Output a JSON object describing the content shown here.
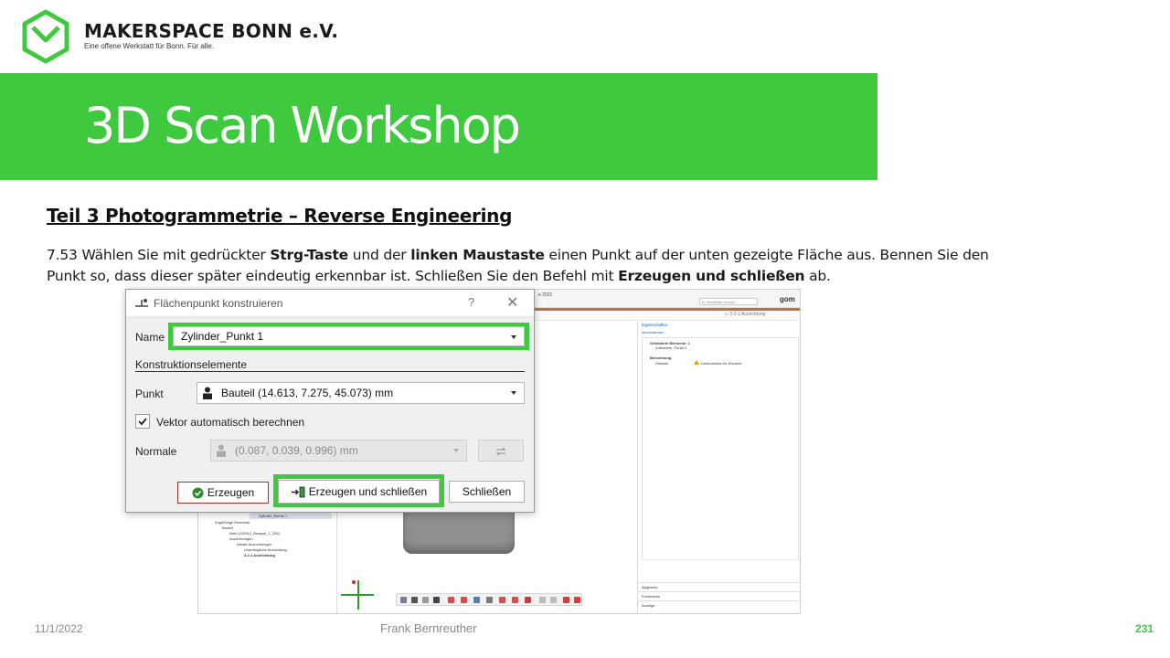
{
  "brand": {
    "name": "MAKERSPACE BONN e.V.",
    "tagline": "Eine offene Werkstatt für Bonn. Für alle.",
    "accent_color": "#3ec93e"
  },
  "banner": {
    "title": "3D Scan Workshop"
  },
  "section": {
    "heading": "Teil 3  Photogrammetrie  – Reverse Engineering"
  },
  "instruction": {
    "p1": "7.53 Wählen Sie mit gedrückter ",
    "b1": "Strg-Taste",
    "p2": " und der ",
    "b2": "linken Maustaste",
    "p3": " einen Punkt auf der unten gezeigte Fläche aus. Bennen Sie den Punkt so, dass dieser später eindeutig erkennbar ist. Schließen Sie den Befehl mit ",
    "b3": "Erzeugen und schließen",
    "p4": " ab."
  },
  "app": {
    "title_fragment": "e 2021",
    "search_placeholder": "In Direkthilfe suchen",
    "logo": "gom",
    "alignment_chip": "▷ 3-2-1 Ausrichtung",
    "tree": {
      "header": "Zylinder_Ebene 1",
      "items": [
        "Zugehörige Elemente",
        "Bauteil",
        "Netz (220912_Beispiel_1_206)",
        "Ausrichtungen",
        "Initiale Ausrichtungen",
        "Ursprüngliche Ausrichtung",
        "3-2-1 Ausrichtung"
      ]
    },
    "panel": {
      "tab": "Eigenschaften",
      "sub": "Informationen",
      "selected_heading": "Selektierte Elemente: 1",
      "selected_item": "Aufnahme_Punkt 4",
      "calc_heading": "Berechnung",
      "hint_label": "Hinweis",
      "hint_value": "Unbenutzbar für Element",
      "footer_items": [
        "Allgemein",
        "Fehlerchen",
        "Anzeige"
      ]
    }
  },
  "dialog": {
    "title": "Flächenpunkt konstruieren",
    "help": "?",
    "close": "✕",
    "name_label": "Name",
    "name_value": "Zylinder_Punkt 1",
    "group_label": "Konstruktionselemente",
    "point_label": "Punkt",
    "point_value": "Bauteil (14.613, 7.275, 45.073) mm",
    "auto_vector_label": "Vektor automatisch berechnen",
    "auto_vector_checked": true,
    "normal_label": "Normale",
    "normal_value": "(0.087, 0.039, 0.996) mm",
    "btn_create": "Erzeugen",
    "btn_create_close": "Erzeugen und schließen",
    "btn_close": "Schließen"
  },
  "footer": {
    "date": "11/1/2022",
    "author": "Frank Bernreuther",
    "page": "231"
  }
}
